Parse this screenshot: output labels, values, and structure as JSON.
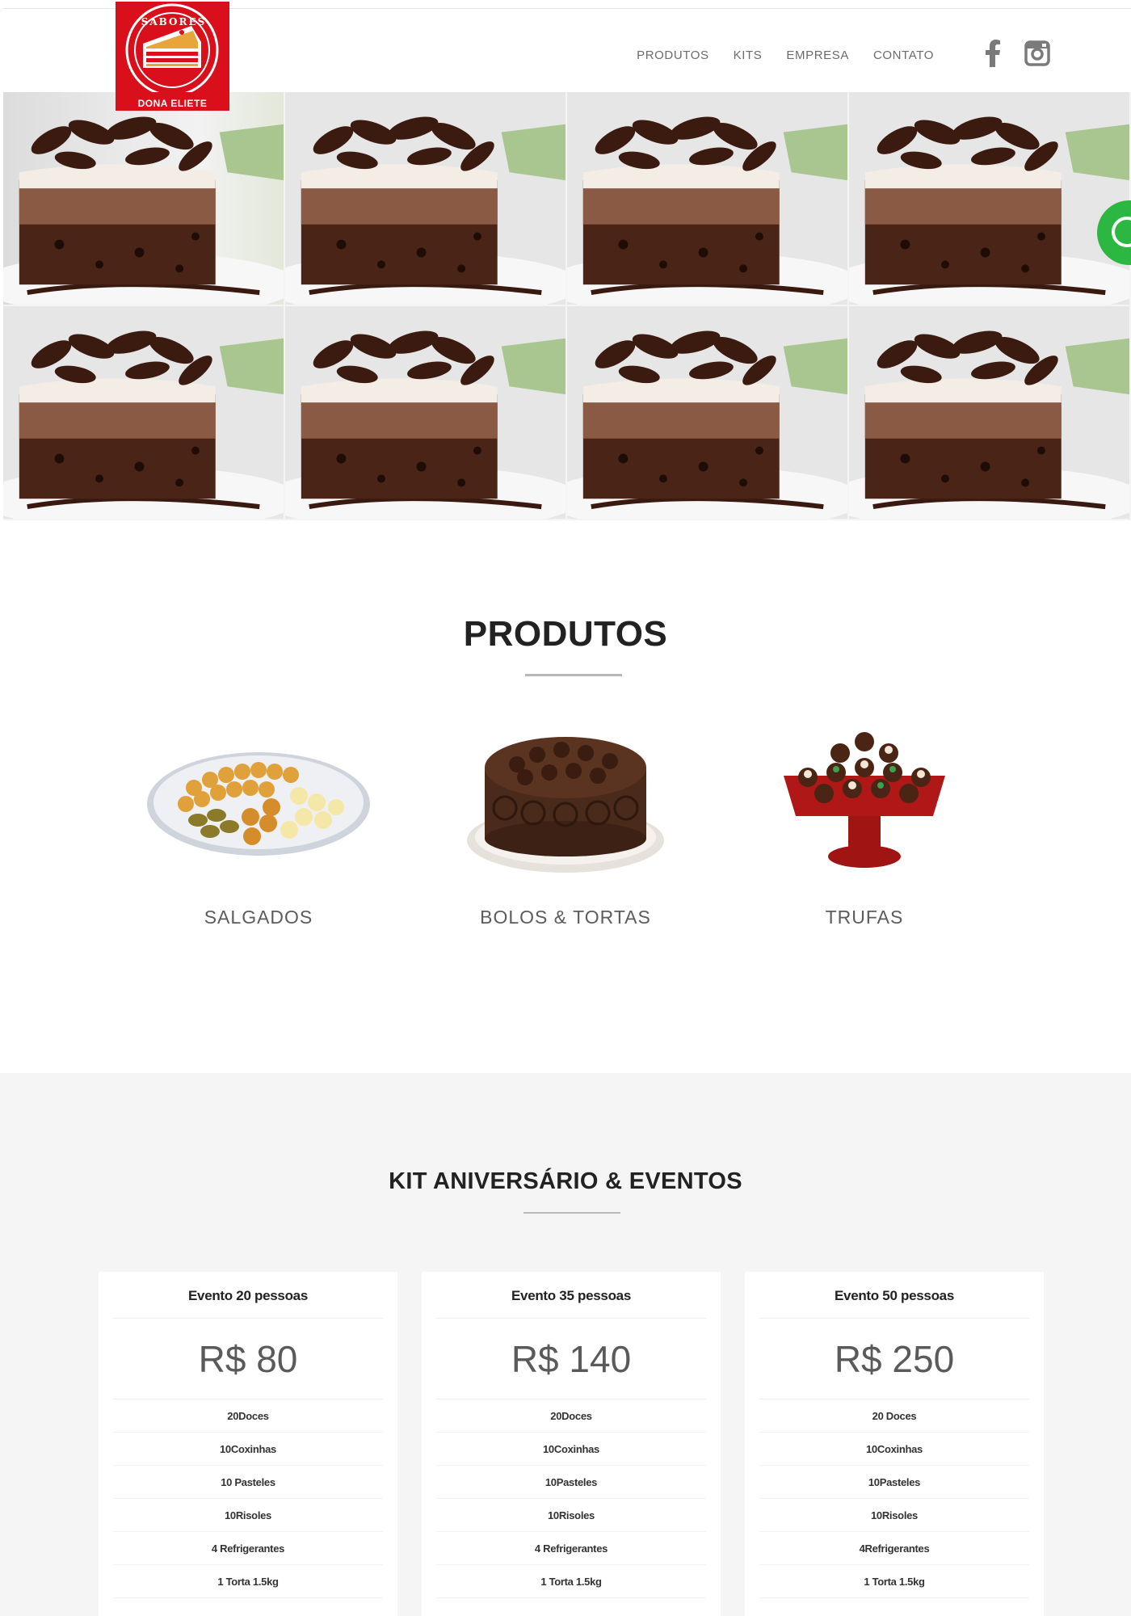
{
  "brand": {
    "logo_top_text": "SABORES",
    "logo_bottom_text": "DONA ELIETE",
    "color": "#d9101c"
  },
  "nav": {
    "items": [
      "PRODUTOS",
      "KITS",
      "EMPRESA",
      "CONTATO"
    ],
    "social": [
      "facebook-icon",
      "instagram-icon"
    ]
  },
  "hero": {
    "tile_image": "chocolate-cake-slice"
  },
  "whatsapp": {
    "icon": "whatsapp-icon",
    "color": "#2bb741"
  },
  "produtos": {
    "title": "PRODUTOS",
    "items": [
      {
        "label": "SALGADOS",
        "image": "salgados-platter"
      },
      {
        "label": "BOLOS & TORTAS",
        "image": "chocolate-rose-cake"
      },
      {
        "label": "TRUFAS",
        "image": "truffles-stand"
      }
    ]
  },
  "kits": {
    "title": "KIT ANIVERSÁRIO & EVENTOS",
    "cards": [
      {
        "title": "Evento 20 pessoas",
        "price": "R$ 80",
        "items": [
          "20Doces",
          "10Coxinhas",
          "10 Pasteles",
          "10Risoles",
          "4 Refrigerantes",
          "1 Torta 1.5kg"
        ]
      },
      {
        "title": "Evento 35 pessoas",
        "price": "R$ 140",
        "items": [
          "20Doces",
          "10Coxinhas",
          "10Pasteles",
          "10Risoles",
          "4 Refrigerantes",
          "1 Torta 1.5kg"
        ]
      },
      {
        "title": "Evento 50 pessoas",
        "price": "R$ 250",
        "items": [
          "20 Doces",
          "10Coxinhas",
          "10Pasteles",
          "10Risoles",
          "4Refrigerantes",
          "1 Torta 1.5kg"
        ]
      }
    ]
  }
}
